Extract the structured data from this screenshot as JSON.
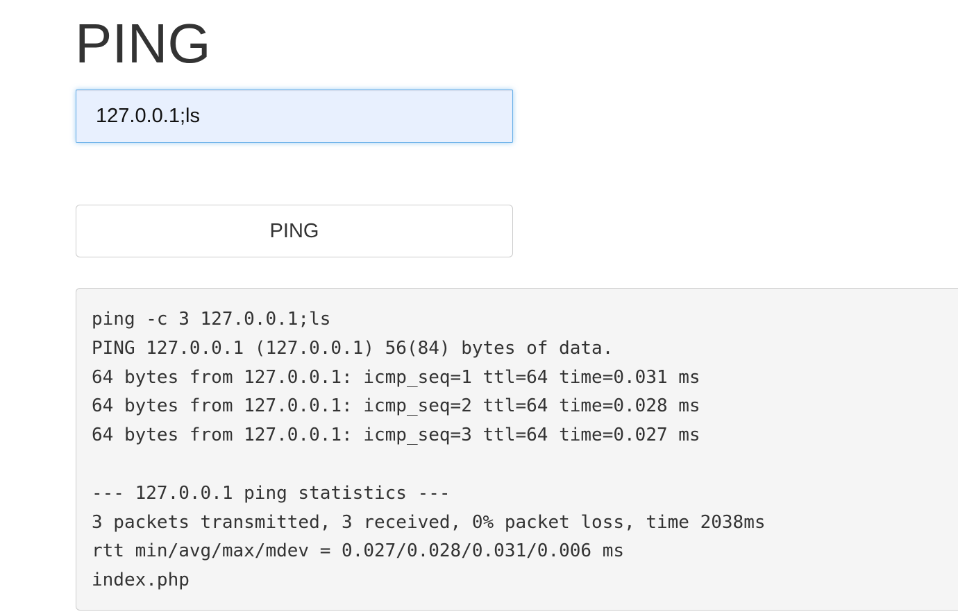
{
  "page": {
    "title": "PING"
  },
  "form": {
    "ip_value": "127.0.0.1;ls",
    "button_label": "PING"
  },
  "output": {
    "lines": [
      "ping -c 3 127.0.0.1;ls",
      "PING 127.0.0.1 (127.0.0.1) 56(84) bytes of data.",
      "64 bytes from 127.0.0.1: icmp_seq=1 ttl=64 time=0.031 ms",
      "64 bytes from 127.0.0.1: icmp_seq=2 ttl=64 time=0.028 ms",
      "64 bytes from 127.0.0.1: icmp_seq=3 ttl=64 time=0.027 ms",
      "",
      "--- 127.0.0.1 ping statistics ---",
      "3 packets transmitted, 3 received, 0% packet loss, time 2038ms",
      "rtt min/avg/max/mdev = 0.027/0.028/0.031/0.006 ms",
      "index.php"
    ]
  },
  "colors": {
    "input_focus_border": "#66afe9",
    "input_autofill_bg": "#e8f0fe",
    "output_bg": "#f5f5f5"
  }
}
